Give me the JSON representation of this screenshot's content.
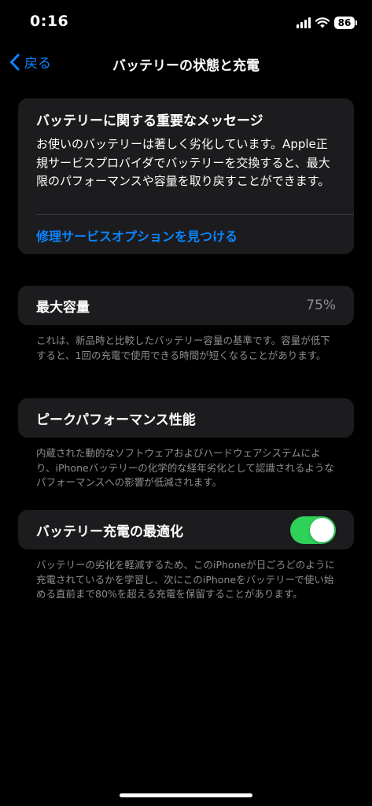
{
  "status_bar": {
    "time": "0:16",
    "battery_level": "86",
    "icons": [
      "signal-icon",
      "wifi-icon",
      "battery-icon"
    ]
  },
  "nav": {
    "back_label": "戻る",
    "title": "バッテリーの状態と充電",
    "back_icon": "chevron-left-icon"
  },
  "message_card": {
    "title": "バッテリーに関する重要なメッセージ",
    "body": "お使いのバッテリーは著しく劣化しています。Apple正規サービスプロバイダでバッテリーを交換すると、最大限のパフォーマンスや容量を取り戻すことができます。",
    "link": "修理サービスオプションを見つける"
  },
  "max_capacity": {
    "label": "最大容量",
    "value": "75%",
    "footnote": "これは、新品時と比較したバッテリー容量の基準です。容量が低下すると、1回の充電で使用できる時間が短くなることがあります。"
  },
  "peak_performance": {
    "label": "ピークパフォーマンス性能",
    "footnote": "内蔵された動的なソフトウェアおよびハードウェアシステムにより、iPhoneバッテリーの化学的な経年劣化として認識されるようなパフォーマンスへの影響が低減されます。"
  },
  "optimized_charging": {
    "label": "バッテリー充電の最適化",
    "enabled": true,
    "footnote": "バッテリーの劣化を軽減するため、このiPhoneが日ごろどのように充電されているかを学習し、次にこのiPhoneをバッテリーで使い始める直前まで80%を超える充電を保留することがあります。"
  },
  "colors": {
    "background": "#000000",
    "card": "#1c1c1e",
    "accent": "#0a84ff",
    "toggle_on": "#30d158",
    "secondary_text": "#8e8e93"
  }
}
